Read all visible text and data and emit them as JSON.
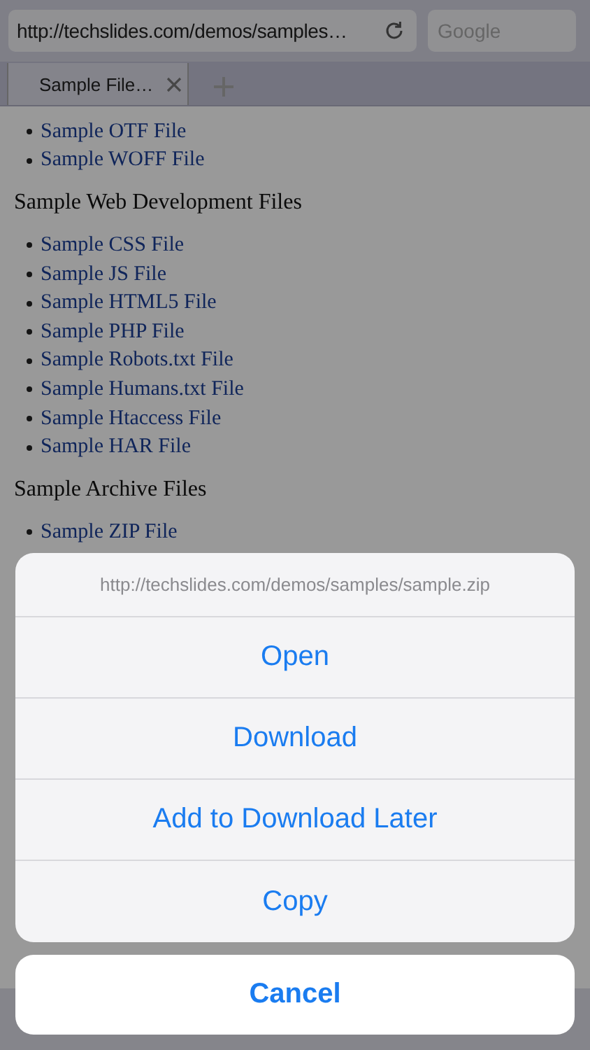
{
  "browser": {
    "address": "http://techslides.com/demos/samples…",
    "search_placeholder": "Google"
  },
  "tabs": [
    {
      "label": "Sample File…",
      "selected": true
    }
  ],
  "page": {
    "sections": [
      {
        "links": [
          "Sample OTF File",
          "Sample WOFF File"
        ]
      },
      {
        "heading": "Sample Web Development Files",
        "links": [
          "Sample CSS File",
          "Sample JS File",
          "Sample HTML5 File",
          "Sample PHP File",
          "Sample Robots.txt File",
          "Sample Humans.txt File",
          "Sample Htaccess File",
          "Sample HAR File"
        ]
      },
      {
        "heading": "Sample Archive Files",
        "links": [
          "Sample ZIP File"
        ]
      }
    ]
  },
  "action_sheet": {
    "title": "http://techslides.com/demos/samples/sample.zip",
    "actions": [
      "Open",
      "Download",
      "Add to Download Later",
      "Copy"
    ],
    "cancel": "Cancel"
  }
}
